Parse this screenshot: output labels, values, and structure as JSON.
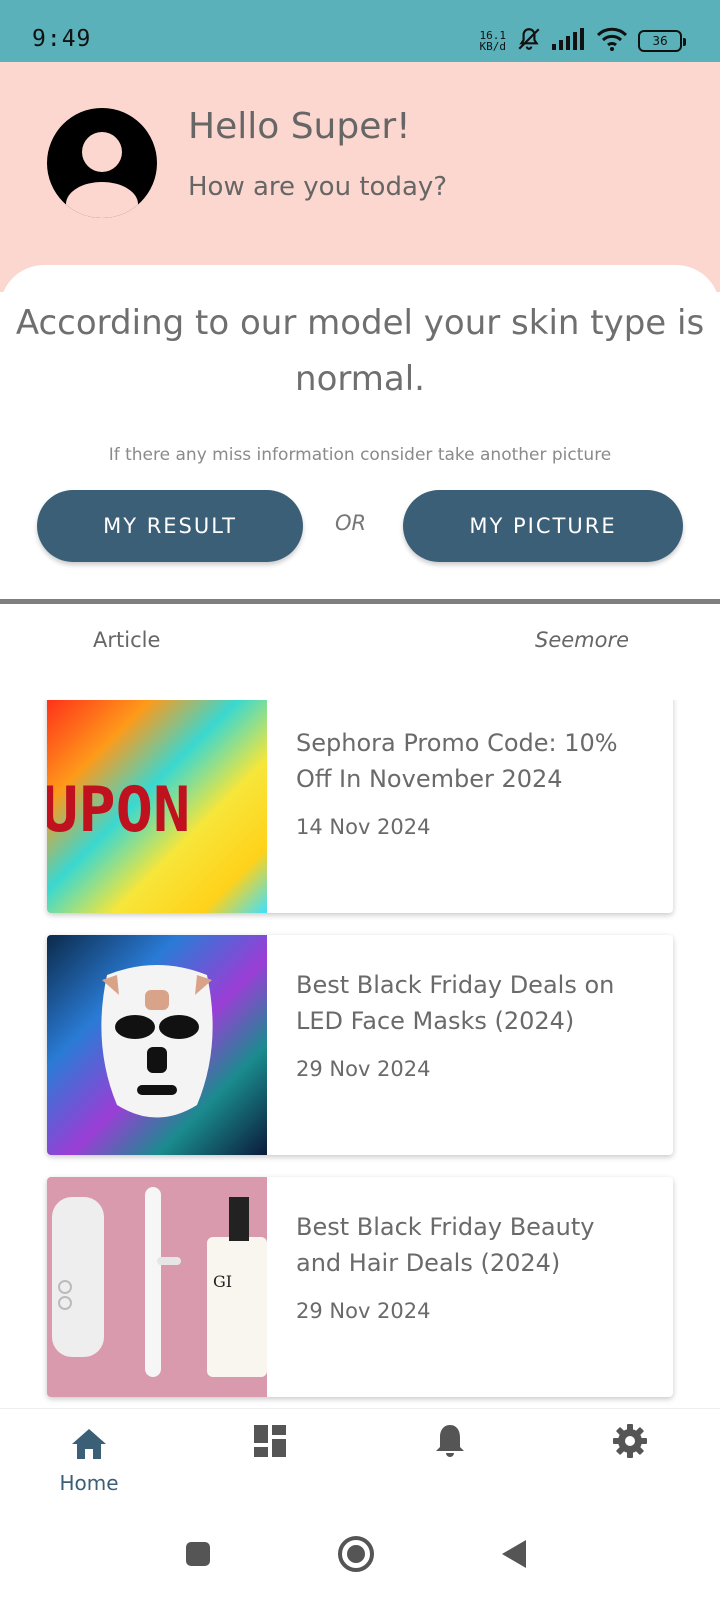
{
  "status_bar": {
    "time": "9:49",
    "net_speed_value": "16.1",
    "net_speed_unit": "KB/d",
    "battery": "36",
    "icons": [
      "bell-off-icon",
      "signal-icon",
      "wifi-icon",
      "battery-icon"
    ]
  },
  "header": {
    "greeting": "Hello Super!",
    "subgreeting": "How are you today?",
    "avatar_icon": "user-avatar-icon"
  },
  "skin_card": {
    "message": "According to our model your skin type is normal.",
    "hint": "If there any miss information consider take another picture",
    "result_button": "MY RESULT",
    "or_label": "OR",
    "picture_button": "MY PICTURE"
  },
  "articles_section": {
    "label": "Article",
    "see_more": "Seemore",
    "items": [
      {
        "title": "Sephora Promo Code: 10% Off In November 2024",
        "date": "14 Nov 2024",
        "thumb_text": "UPON"
      },
      {
        "title": "Best Black Friday Deals on LED Face Masks (2024)",
        "date": "29 Nov 2024"
      },
      {
        "title": "Best Black Friday Beauty and Hair Deals (2024)",
        "date": "29 Nov 2024"
      }
    ]
  },
  "bottom_nav": {
    "home_label": "Home",
    "items": [
      "home-icon",
      "dashboard-icon",
      "notification-bell-icon",
      "settings-gear-icon"
    ]
  },
  "colors": {
    "status_bar": "#5ab1b9",
    "header_bg": "#fcd7cf",
    "primary_button": "#3c5f78",
    "nav_active": "#3c5f78",
    "nav_inactive": "#555555"
  }
}
